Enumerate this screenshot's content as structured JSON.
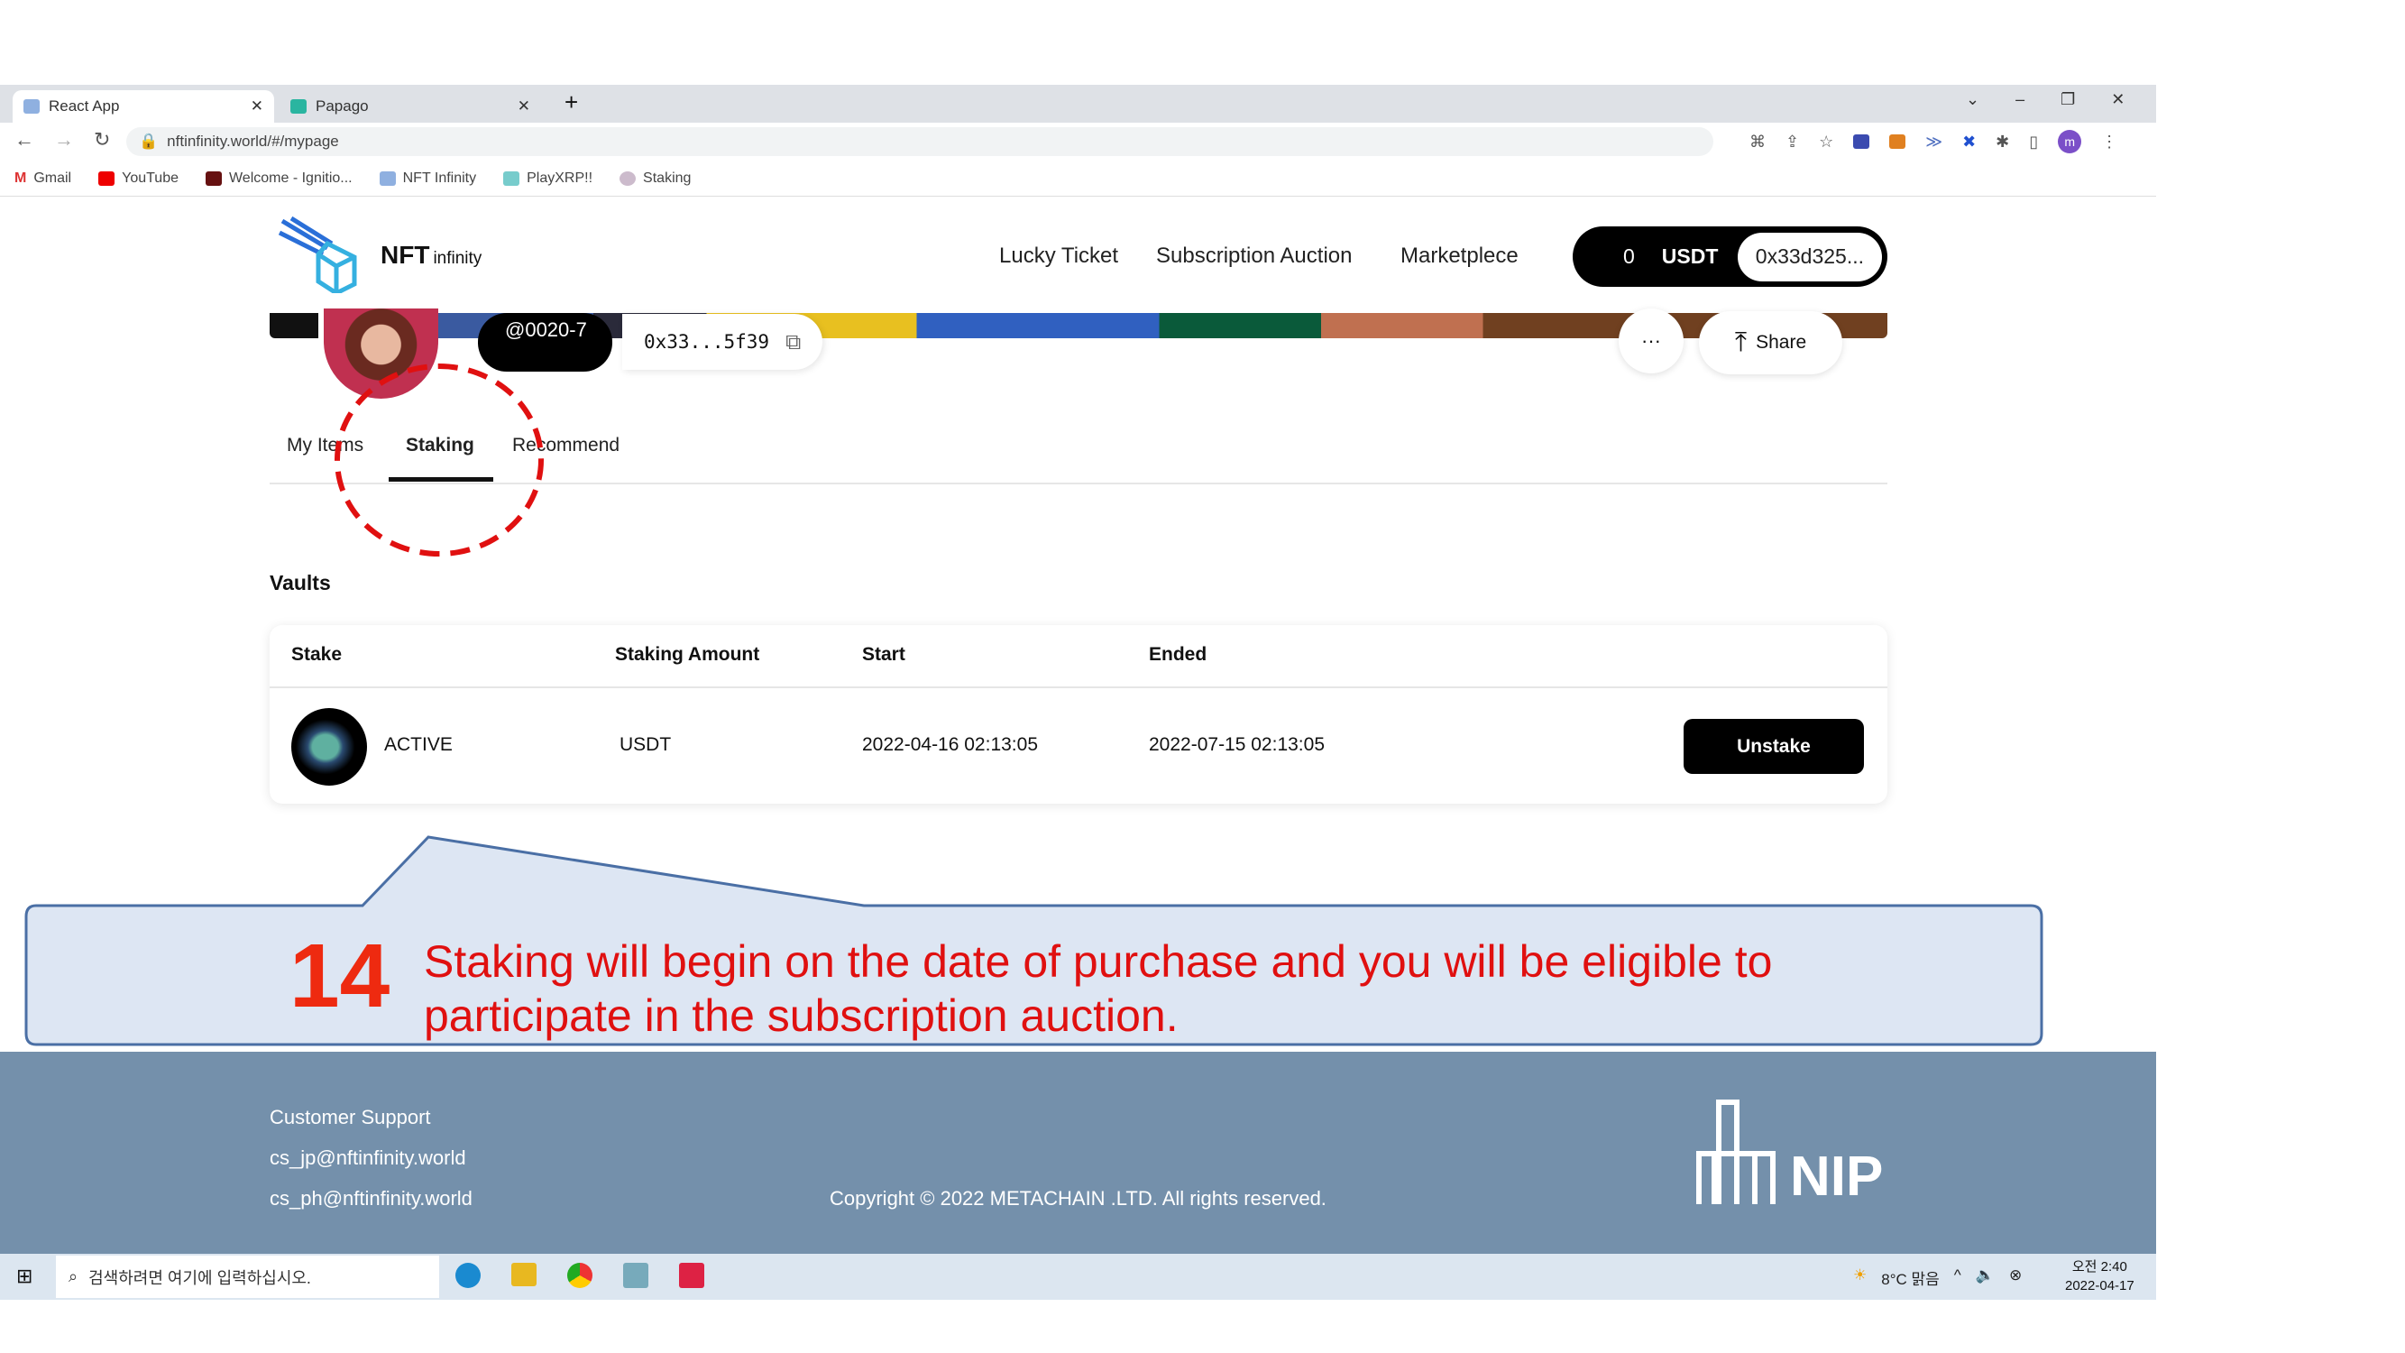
{
  "browser": {
    "tabs": [
      {
        "label": "React App"
      },
      {
        "label": "Papago"
      }
    ],
    "url": "nftinfinity.world/#/mypage",
    "bookmarks": [
      "Gmail",
      "YouTube",
      "Welcome - Ignitio...",
      "NFT Infinity",
      "PlayXRP!!",
      "Staking"
    ],
    "profile_initial": "m"
  },
  "header": {
    "logo_text": "NFT",
    "logo_sub": "infinity",
    "nav": [
      "Lucky Ticket",
      "Subscription Auction",
      "Marketplece"
    ],
    "balance": "0",
    "currency": "USDT",
    "wallet": "0x33d325..."
  },
  "profile": {
    "username": "@0020-7",
    "address": "0x33...5f39",
    "more": "···",
    "share": "Share"
  },
  "tabs": [
    {
      "label": "My Items"
    },
    {
      "label": "Staking",
      "active": true
    },
    {
      "label": "Recommend"
    }
  ],
  "vaults": {
    "title": "Vaults",
    "columns": [
      "Stake",
      "Staking Amount",
      "Start",
      "Ended"
    ],
    "rows": [
      {
        "status": "ACTIVE",
        "amount": "USDT",
        "start": "2022-04-16 02:13:05",
        "ended": "2022-07-15 02:13:05",
        "action": "Unstake"
      }
    ]
  },
  "callout": {
    "step": "14",
    "line1": "Staking will begin on the date of purchase and you will be eligible to",
    "line2": "participate in the subscription auction."
  },
  "footer": {
    "support_title": "Customer Support",
    "emails": [
      "cs_jp@nftinfinity.world",
      "cs_ph@nftinfinity.world"
    ],
    "copyright": "Copyright © 2022 METACHAIN .LTD. All rights reserved.",
    "brand": "NIP"
  },
  "taskbar": {
    "search_placeholder": "검색하려면 여기에 입력하십시오.",
    "weather": "8°C 맑음",
    "time": "오전 2:40",
    "date": "2022-04-17"
  },
  "colors": {
    "annotation": "#e01010",
    "footer": "#7490ab",
    "callout_fill": "#dde6f3"
  }
}
